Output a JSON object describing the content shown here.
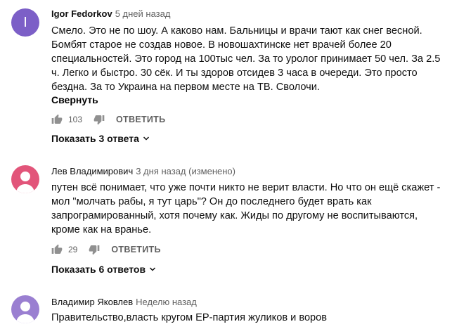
{
  "colors": {
    "avatar_1": "#7c5fc7",
    "avatar_2": "#e2557a",
    "avatar_3": "#9a7fd1",
    "text": "#0f0f0f",
    "secondary": "#606060"
  },
  "comments": [
    {
      "avatar_letter": "I",
      "author": "Igor Fedorkov",
      "time": "5 дней назад",
      "lines": [
        "Смело. Это не по шоу. А каково нам. Бальницы и врачи тают как снег весной.",
        "Бомбят старое не создав новое. В новошахтинске нет врачей более 20",
        "специальностей. Это город на 100тыс чел.  За то уролог принимает 50 чел. За 2.5",
        "ч. Легко и быстро. 30 сёк. И ты здоров отсидев 3 часа в очереди.  Это просто",
        "бездна. За то Украина на первом месте на ТВ. Сволочи."
      ],
      "collapse_label": "Свернуть",
      "likes": "103",
      "reply_label": "ОТВЕТИТЬ",
      "show_replies": "Показать 3 ответа"
    },
    {
      "author": "Лев Владимирович",
      "time": "3 дня назад (изменено)",
      "lines": [
        "путен всё понимает, что уже почти никто не верит власти. Но что он ещё скажет -",
        "мол \"молчать рабы, я тут царь\"? Он до последнего будет врать как",
        "запрограмированный, хотя почему как. Жиды по другому не воспитываются,",
        "кроме как на вранье."
      ],
      "likes": "29",
      "reply_label": "ОТВЕТИТЬ",
      "show_replies": "Показать 6 ответов"
    },
    {
      "author": "Владимир Яковлев",
      "time": "Неделю назад",
      "lines": [
        "Правительство,власть кругом ЕР-партия жуликов и воров"
      ]
    }
  ]
}
